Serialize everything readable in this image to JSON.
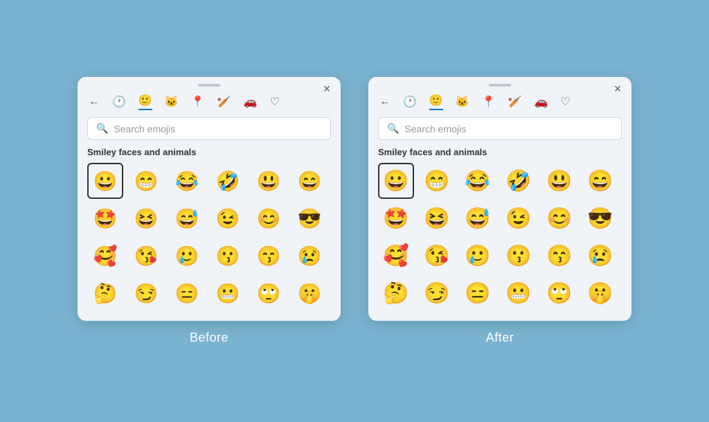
{
  "before": {
    "label": "Before",
    "search_placeholder": "Search emojis",
    "section_title": "Smiley faces and animals",
    "nav_icons": [
      "←",
      "🕐",
      "🙂",
      "🐱",
      "📍",
      "🏏",
      "🚗",
      "♡"
    ],
    "emojis": [
      "😀",
      "😁",
      "😂",
      "🤣",
      "😃",
      "😄",
      "🤩",
      "😆",
      "😅",
      "😉",
      "😊",
      "😎",
      "🥰",
      "😘",
      "🥲",
      "😗",
      "😙",
      "😢",
      "🤔",
      "😏",
      "😑",
      "😬",
      "🙄",
      "🤫"
    ],
    "selected_index": 0
  },
  "after": {
    "label": "After",
    "search_placeholder": "Search emojis",
    "section_title": "Smiley faces and animals",
    "nav_icons": [
      "←",
      "🕐",
      "🙂",
      "🐱",
      "📍",
      "🏏",
      "🚗",
      "♡"
    ],
    "emojis": [
      "😀",
      "😁",
      "😂",
      "🤣",
      "😃",
      "😄",
      "🤩",
      "😆",
      "😅",
      "😉",
      "😊",
      "😎",
      "🥰",
      "😘",
      "🥲",
      "😗",
      "😙",
      "😢",
      "🤔",
      "😏",
      "😑",
      "😬",
      "🙄",
      "🤫"
    ],
    "selected_index": 0
  }
}
